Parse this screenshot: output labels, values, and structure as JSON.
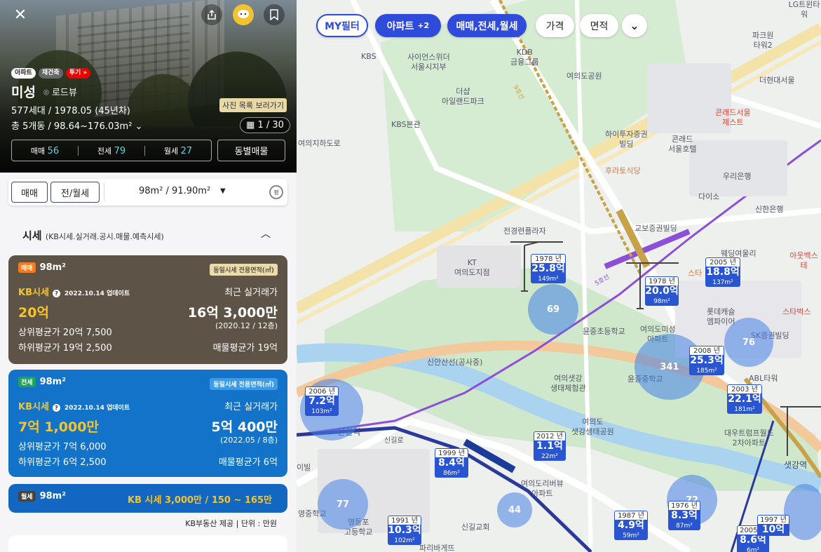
{
  "hero": {
    "tags": [
      "아파트",
      "재건축",
      "투기 »"
    ],
    "name": "미성",
    "roadview": "로드뷰",
    "info1": "577세대 / 1978.05 (45년차)",
    "info2": "총 5개동 / 98.64~176.03m²",
    "photo_tip": "사진 목록 보러가기",
    "photo_count": "1 / 30",
    "trades": [
      {
        "label": "매매",
        "count": "56"
      },
      {
        "label": "전세",
        "count": "79"
      },
      {
        "label": "월세",
        "count": "27"
      }
    ],
    "dong_button": "동별매물"
  },
  "filter": {
    "sale": "매매",
    "rent": "전/월세",
    "area": "98m² / 91.90m²",
    "area_icon_label": "평"
  },
  "sise": {
    "title": "시세",
    "subtitle": "(KB시세.실거래.공시.매물.예측시세)"
  },
  "cards": {
    "sale": {
      "badge": "매매",
      "area": "98m²",
      "same_label": "동일시세 전용면적(㎡)",
      "kb_label": "KB시세",
      "kb_date": "2022.10.14 업데이트",
      "recent_label": "최근 실거래가",
      "kb_price": "20억",
      "recent_price": "16억 3,000만",
      "recent_sub": "(2020.12 / 12층)",
      "upper": "상위평균가  20억 7,500",
      "lower": "하위평균가  19억 2,500",
      "listing": "매물평균가  19억"
    },
    "jeonse": {
      "badge": "전세",
      "area": "98m²",
      "same_label": "동일시세 전용면적(㎡)",
      "kb_label": "KB시세",
      "kb_date": "2022.10.14 업데이트",
      "recent_label": "최근 실거래가",
      "kb_price": "7억 1,000만",
      "recent_price": "5억 400만",
      "recent_sub": "(2022.05 / 8층)",
      "upper": "상위평균가  7억 6,000",
      "lower": "하위평균가  6억 2,500",
      "listing": "매물평균가  6억"
    },
    "monthly": {
      "badge": "월세",
      "area": "98m²",
      "kb": "KB 시세  3,000만 / 150 ~ 165만"
    },
    "source": "KB부동산 제공  |  단위 : 만원"
  },
  "map": {
    "chips": {
      "my": "MY필터",
      "apt": "아파트",
      "apt_more": "+2",
      "trade": "매매,전세,월세",
      "price": "가격",
      "area": "면적"
    },
    "pois": [
      {
        "t": "KBS"
      },
      {
        "t": "사이언스위더\n서울시지부"
      },
      {
        "t": "KDB\n금융그룹"
      },
      {
        "t": "여의도공원"
      },
      {
        "t": "더샵\n아일랜드파크"
      },
      {
        "t": "KBS본관"
      },
      {
        "t": "하이투자증권\n빌딩"
      },
      {
        "t": "콘래드\n서울호텔"
      },
      {
        "t": "후라토식당"
      },
      {
        "t": "콘래드서울\n제스트"
      },
      {
        "t": "파크원\n타워2"
      },
      {
        "t": "더현대서울"
      },
      {
        "t": "우리은행"
      },
      {
        "t": "다이소"
      },
      {
        "t": "신한은행"
      },
      {
        "t": "여의지하도로"
      },
      {
        "t": "전경련플라자"
      },
      {
        "t": "KT\n여의도지점"
      },
      {
        "t": "교보증권빌딩"
      },
      {
        "t": "웨딩여울리"
      },
      {
        "t": "아웃백스테"
      },
      {
        "t": "스타"
      },
      {
        "t": "롯데캐슬\n엠파이어"
      },
      {
        "t": "스타벅스"
      },
      {
        "t": "SK증권빌딩"
      },
      {
        "t": "ABL타워"
      },
      {
        "t": "윤중초등학교"
      },
      {
        "t": "여의도미성\n아파트"
      },
      {
        "t": "윤중중학교"
      },
      {
        "t": "신안산선(공사중)"
      },
      {
        "t": "여의샛강\n생태체험관"
      },
      {
        "t": "여의도\n샛강생태공원"
      },
      {
        "t": "대우트럼프월드\n2차아파트"
      },
      {
        "t": "샛강역"
      },
      {
        "t": "신길역"
      },
      {
        "t": "여의도리버뷰\n아파트"
      },
      {
        "t": "신길교회"
      },
      {
        "t": "파리바게뜨"
      },
      {
        "t": "영등포\n고등학교"
      },
      {
        "t": "영중학교"
      },
      {
        "t": "LG트윈타워"
      },
      {
        "t": "5호선"
      },
      {
        "t": "9호선"
      },
      {
        "t": "신길로"
      },
      {
        "t": "이빌"
      }
    ],
    "markers": [
      {
        "yr": "1978 년",
        "pr": "25.8억",
        "ar": "149m²"
      },
      {
        "yr": "1978 년",
        "pr": "20.0억",
        "ar": "98m²"
      },
      {
        "yr": "2005 년",
        "pr": "18.8억",
        "ar": "137m²"
      },
      {
        "yr": "2008 년",
        "pr": "25.3억",
        "ar": "185m²"
      },
      {
        "yr": "2006 년",
        "pr": "7.2억",
        "ar": "103m²"
      },
      {
        "yr": "2003 년",
        "pr": "22.1억",
        "ar": "181m²"
      },
      {
        "yr": "2012 년",
        "pr": "1.1억",
        "ar": "22m²"
      },
      {
        "yr": "1999 년",
        "pr": "8.4억",
        "ar": "86m²"
      },
      {
        "yr": "1991 년",
        "pr": "10.3억",
        "ar": "102m²"
      },
      {
        "yr": "1987 년",
        "pr": "4.9억",
        "ar": "59m²"
      },
      {
        "yr": "1976 년",
        "pr": "8.3억",
        "ar": "87m²"
      },
      {
        "yr": "2005 년",
        "pr": "8.6억",
        "ar": "6m²"
      },
      {
        "yr": "1997 년",
        "pr": "10억",
        "ar": ""
      }
    ],
    "clusters": [
      "69",
      "341",
      "76",
      "77",
      "44",
      "72"
    ]
  }
}
